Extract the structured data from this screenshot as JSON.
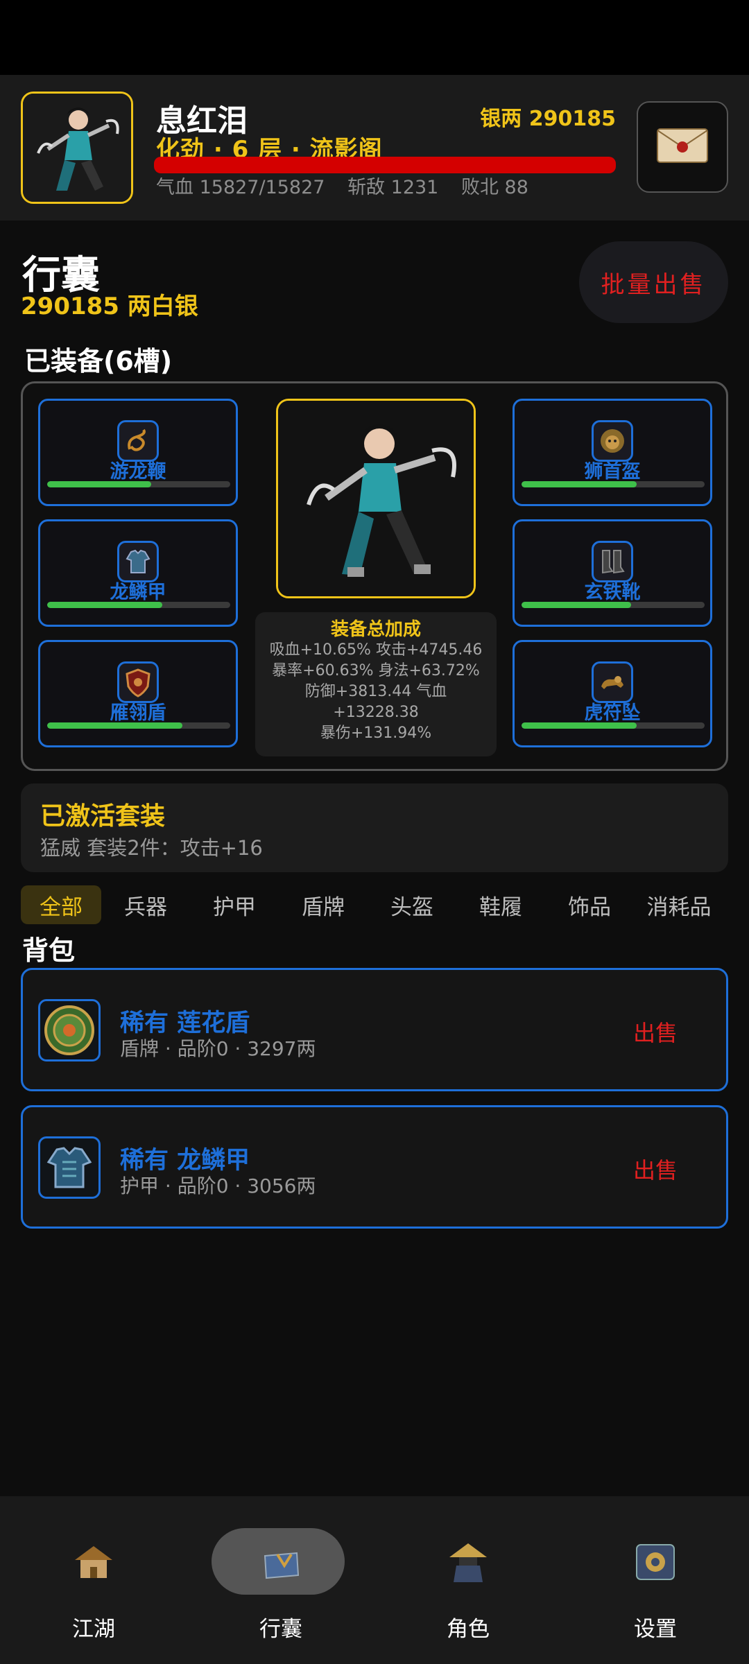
{
  "hero": {
    "name": "息红泪",
    "rank": "化劲 · 6 层 · 流影阁",
    "silver": "银两 290185",
    "hp_fraction": 1.0,
    "stats": [
      "气血 15827/15827",
      "斩敌 1231",
      "败北 88"
    ]
  },
  "bag": {
    "title": "行囊",
    "silver": "290185 两白银",
    "bulk_sell": "批量出售",
    "equipped_title": "已装备(6槽)",
    "pack_title": "背包"
  },
  "slots": [
    {
      "name": "游龙鞭",
      "durability": 0.57,
      "icon": "dragon-whip-icon"
    },
    {
      "name": "龙鳞甲",
      "durability": 0.63,
      "icon": "dragon-armor-icon"
    },
    {
      "name": "雁翎盾",
      "durability": 0.74,
      "icon": "shield-icon"
    },
    {
      "name": "狮首盔",
      "durability": 0.63,
      "icon": "lion-helmet-icon"
    },
    {
      "name": "玄铁靴",
      "durability": 0.6,
      "icon": "iron-boots-icon"
    },
    {
      "name": "虎符坠",
      "durability": 0.63,
      "icon": "tiger-talisman-icon"
    }
  ],
  "bonus": {
    "title": "装备总加成",
    "lines": [
      "吸血+10.65% 攻击+4745.46",
      "暴率+60.63% 身法+63.72%",
      "防御+3813.44 气血",
      "+13228.38",
      "暴伤+131.94%"
    ]
  },
  "set": {
    "title": "已激活套装",
    "desc": "猛威 套装2件：攻击+16"
  },
  "tabs": [
    "全部",
    "兵器",
    "护甲",
    "盾牌",
    "头盔",
    "鞋履",
    "饰品",
    "消耗品"
  ],
  "items": [
    {
      "name": "稀有 莲花盾",
      "meta": "盾牌 · 品阶0 · 3297两",
      "sell": "出售",
      "icon": "lotus-shield-icon"
    },
    {
      "name": "稀有 龙鳞甲",
      "meta": "护甲 · 品阶0 · 3056两",
      "sell": "出售",
      "icon": "dragon-armor-icon"
    }
  ],
  "nav": [
    {
      "label": "江湖",
      "icon": "jianghu-house-icon"
    },
    {
      "label": "行囊",
      "icon": "bag-icon"
    },
    {
      "label": "角色",
      "icon": "character-hat-icon"
    },
    {
      "label": "设置",
      "icon": "settings-gear-icon"
    }
  ],
  "colors": {
    "accent_gold": "#f0c419",
    "rare_blue": "#1e6fd9",
    "sell_red": "#e02020",
    "hp_red": "#d40000",
    "durability_green": "#3fc04a"
  }
}
